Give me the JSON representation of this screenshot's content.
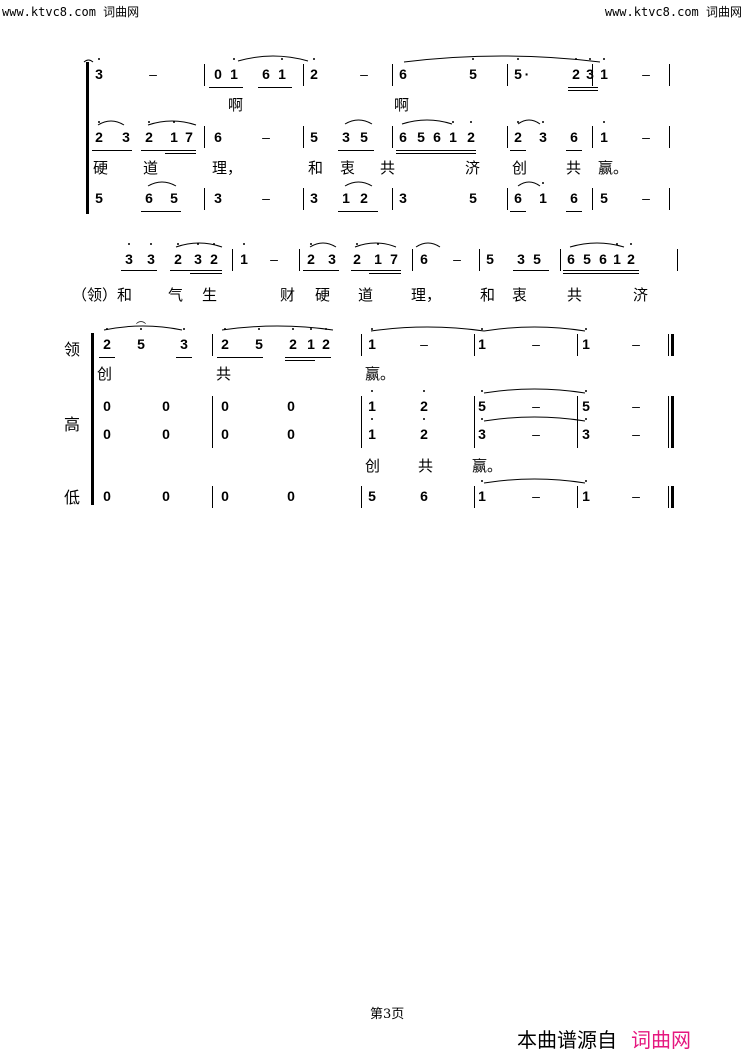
{
  "watermark": {
    "left": "www.ktvc8.com 词曲网",
    "right": "www.ktvc8.com 词曲网"
  },
  "system1": {
    "lead_notes": [
      "3̇",
      "–",
      "0",
      "1̇",
      "6",
      "1̇",
      "2̇",
      "–",
      "6",
      "5̇",
      "5̇·",
      "2̇3̇",
      "1̇",
      "–"
    ],
    "lead_lyrics": [
      "啊",
      "啊"
    ],
    "mid_notes": [
      "2̇",
      "3",
      "2̇",
      "1̇",
      "7",
      "6",
      "–",
      "5",
      "3",
      "5",
      "6",
      "5",
      "6",
      "1̇",
      "2̇",
      "2̇",
      "3̇",
      "6",
      "1̇",
      "–"
    ],
    "mid_lyrics": [
      "硬",
      "道",
      "理，",
      "和",
      "衷",
      "共",
      "济",
      "创",
      "共",
      "赢。"
    ],
    "low_notes": [
      "5",
      "6",
      "5",
      "3",
      "–",
      "3",
      "1",
      "2",
      "3",
      "5",
      "6",
      "1̇",
      "6",
      "5",
      "–"
    ]
  },
  "system2": {
    "notes": [
      "3̇",
      "3̇",
      "2̇",
      "3̇",
      "2̇",
      "1̇",
      "–",
      "2̇",
      "3",
      "2̇",
      "1̇",
      "7",
      "6",
      "–",
      "5",
      "3",
      "5",
      "6",
      "5",
      "6",
      "1̇",
      "2̇"
    ],
    "lyrics": [
      "（领）和",
      "气",
      "生",
      "财",
      "硬",
      "道",
      "理，",
      "和",
      "衷",
      "共",
      "济"
    ]
  },
  "system3": {
    "part_labels": {
      "lead": "领",
      "high": "高",
      "low": "低"
    },
    "lead_notes": [
      "2̇",
      "5̇",
      "3̇",
      "2̇",
      "5̇",
      "2̇",
      "1̇",
      "2̇",
      "1̇",
      "–",
      "1̇",
      "–",
      "1̇",
      "–"
    ],
    "lead_lyrics": [
      "创",
      "共",
      "赢。"
    ],
    "high1_notes": [
      "0",
      "0",
      "0",
      "0",
      "1̇",
      "2̇",
      "5̇",
      "–",
      "5̇",
      "–"
    ],
    "high2_notes": [
      "0",
      "0",
      "0",
      "0",
      "1̇",
      "2̇",
      "3̇",
      "–",
      "3̇",
      "–"
    ],
    "high_lyrics": [
      "创",
      "共",
      "赢。"
    ],
    "low_notes": [
      "0",
      "0",
      "0",
      "0",
      "5",
      "6",
      "1̇",
      "–",
      "1̇",
      "–"
    ]
  },
  "footer": {
    "page": "第3页",
    "source_prefix": "本曲谱源自",
    "source_brand": "词曲网",
    "brand_color": "#e5177f"
  }
}
